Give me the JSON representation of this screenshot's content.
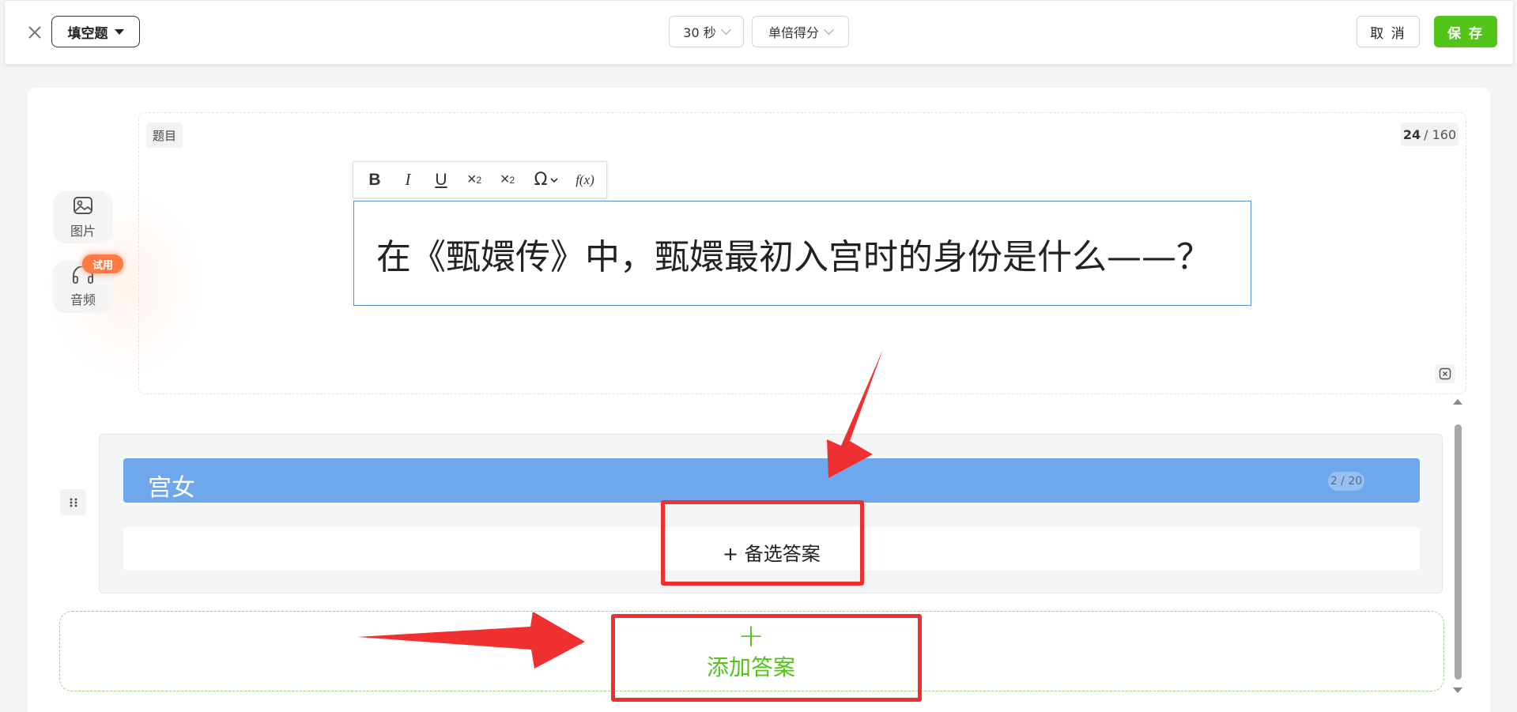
{
  "header": {
    "question_type": "填空题",
    "time_limit": "30 秒",
    "scoring": "单倍得分",
    "cancel_label": "取 消",
    "save_label": "保 存"
  },
  "side_tools": {
    "image_label": "图片",
    "audio_label": "音频",
    "trial_badge": "试用"
  },
  "question": {
    "tag": "题目",
    "char_count": "24",
    "char_limit": "/ 160",
    "text": "在《甄嬛传》中，甄嬛最初入宫时的身份是什么——？"
  },
  "toolbar": {
    "bold": "B",
    "italic": "I",
    "underline": "U",
    "superscript_base": "×",
    "superscript_exp": "2",
    "subscript_base": "×",
    "subscript_exp": "2",
    "special_char": "Ω",
    "formula": "f(x)"
  },
  "answers": [
    {
      "text": "宫女",
      "count": "2 / 20"
    }
  ],
  "alt_answer_label": "+ 备选答案",
  "add_answer": {
    "plus": "+",
    "label": "添加答案"
  },
  "colors": {
    "accent_green": "#52c41a",
    "answer_blue": "#6fa7ec",
    "editor_border": "#5b8fd6",
    "annotation_red": "#f03030",
    "trial_orange": "#ff7a45"
  }
}
